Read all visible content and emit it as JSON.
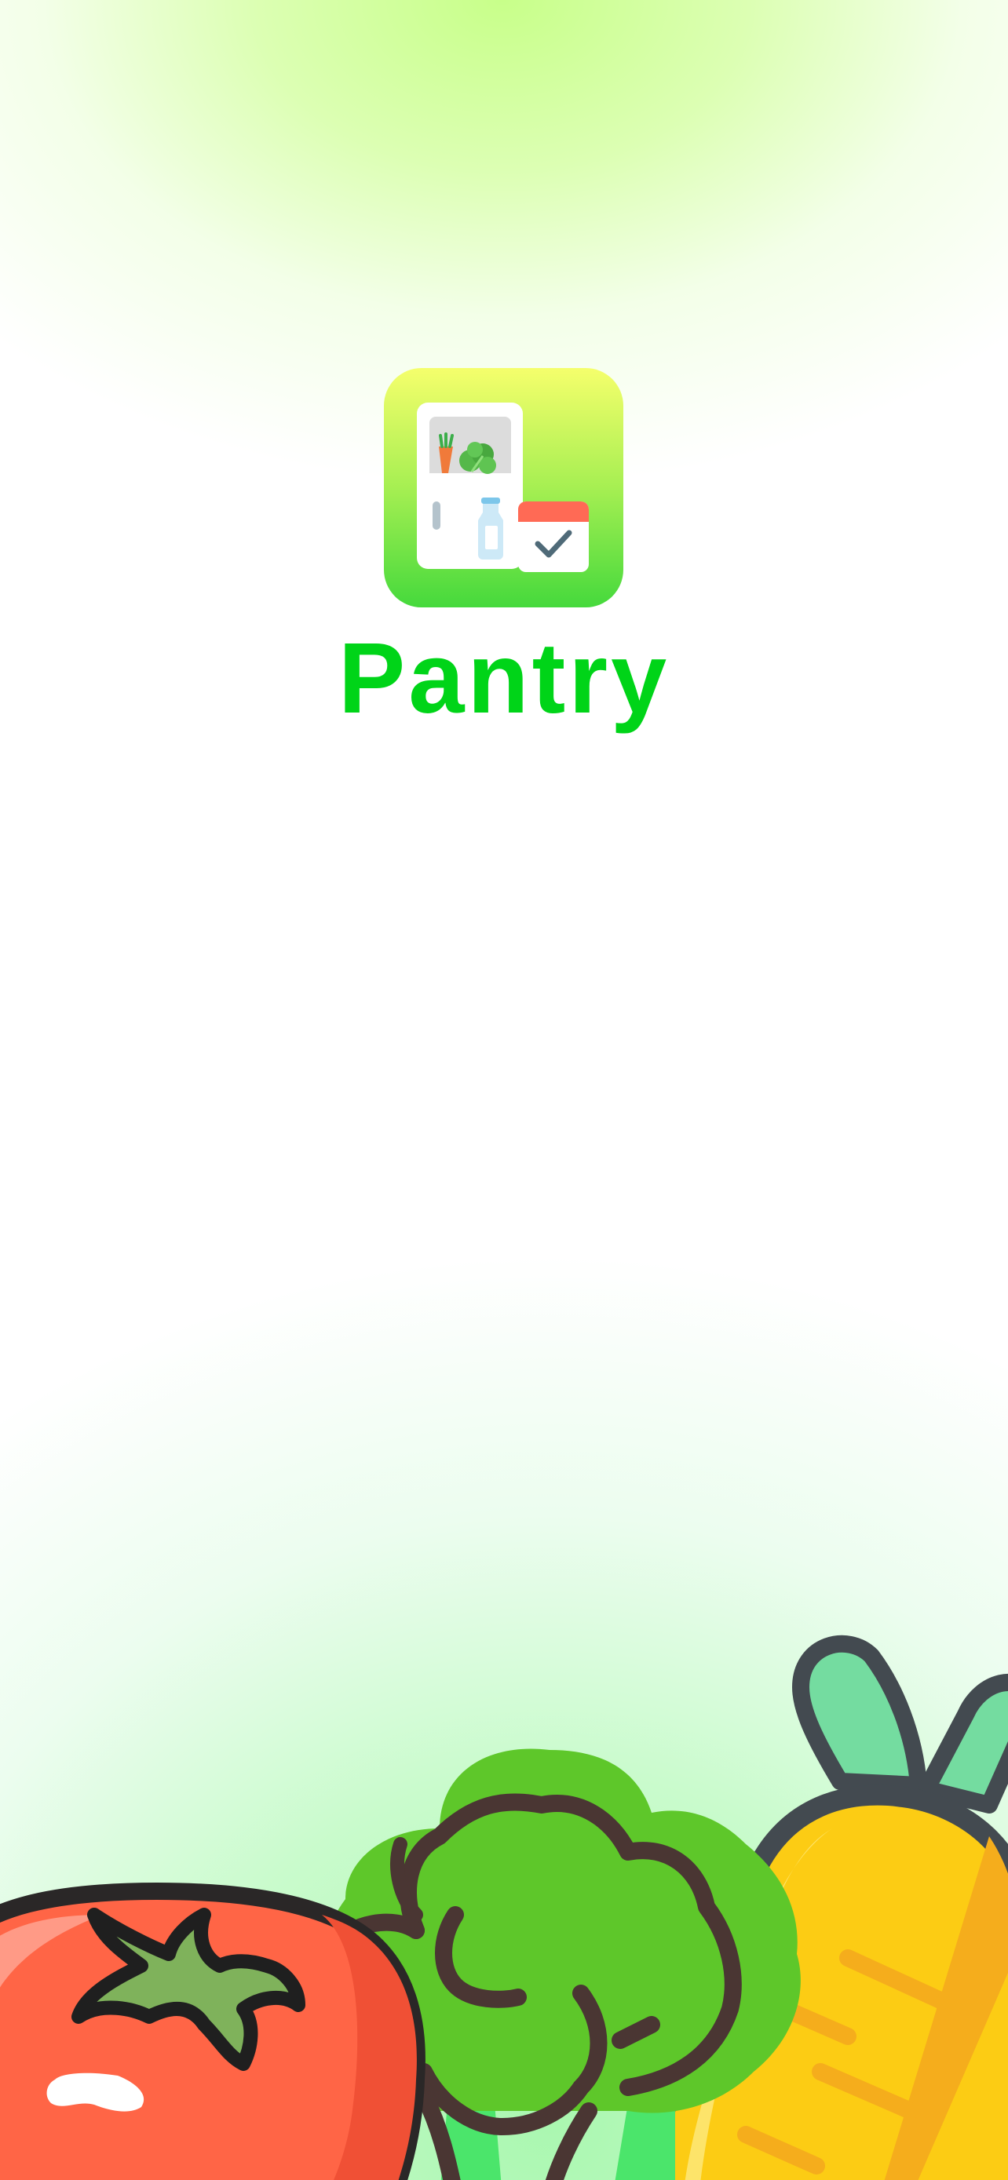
{
  "app": {
    "name": "Pantry",
    "title_color": "#00d418"
  },
  "colors": {
    "top_glow": "#c8ff8a",
    "bottom_glow": "#aaf7b0",
    "icon_gradient_top": "#f2ff6a",
    "icon_gradient_bottom": "#4fdc3c"
  },
  "icons": {
    "app_icon": "fridge-with-calendar-icon",
    "illustration": "tomato-broccoli-carrot-illustration"
  }
}
